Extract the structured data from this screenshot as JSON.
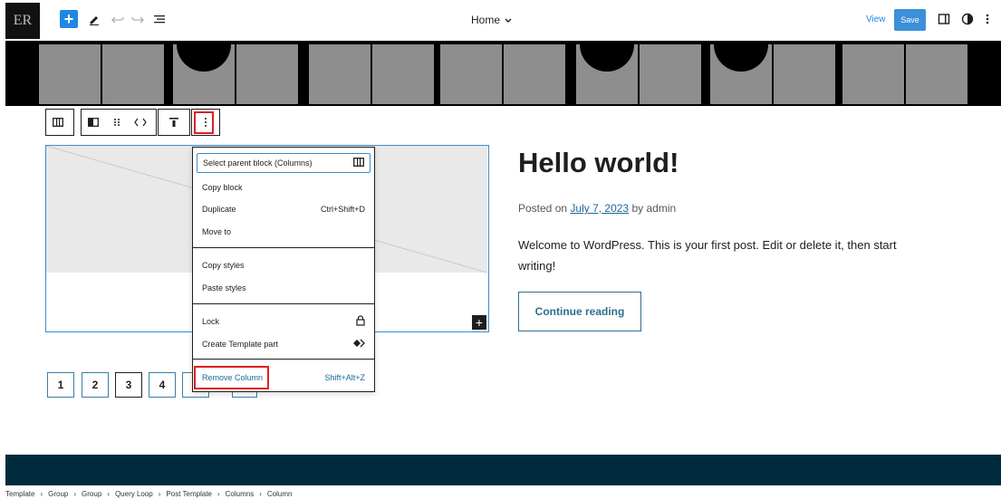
{
  "topbar": {
    "logo_text": "ER",
    "add_label": "+",
    "document_title": "Home",
    "view_label": "View",
    "save_label": "Save"
  },
  "block_toolbar": {
    "more_label": "⋮"
  },
  "block_menu": {
    "items": [
      {
        "label": "Select parent block (Columns)",
        "shortcut": ""
      },
      {
        "label": "Copy block",
        "shortcut": ""
      },
      {
        "label": "Duplicate",
        "shortcut": "Ctrl+Shift+D"
      },
      {
        "label": "Move to",
        "shortcut": ""
      },
      {
        "label": "Copy styles",
        "shortcut": ""
      },
      {
        "label": "Paste styles",
        "shortcut": ""
      },
      {
        "label": "Lock",
        "shortcut": ""
      },
      {
        "label": "Create Template part",
        "shortcut": ""
      },
      {
        "label": "Remove Column",
        "shortcut": "Shift+Alt+Z"
      }
    ]
  },
  "pagination": [
    "1",
    "2",
    "3",
    "4"
  ],
  "post": {
    "title": "Hello world!",
    "meta_prefix": "Posted on",
    "date": "July 7, 2023",
    "meta_by": "by",
    "author": "admin",
    "excerpt": "Welcome to WordPress. This is your first post. Edit or delete it, then start writing!",
    "continue_label": "Continue reading"
  },
  "breadcrumb": [
    "Template",
    "Group",
    "Group",
    "Query Loop",
    "Post Template",
    "Columns",
    "Column"
  ],
  "colors": {
    "accent": "#1e88e5",
    "footer": "#002b3d",
    "highlight": "#e01f1f"
  }
}
